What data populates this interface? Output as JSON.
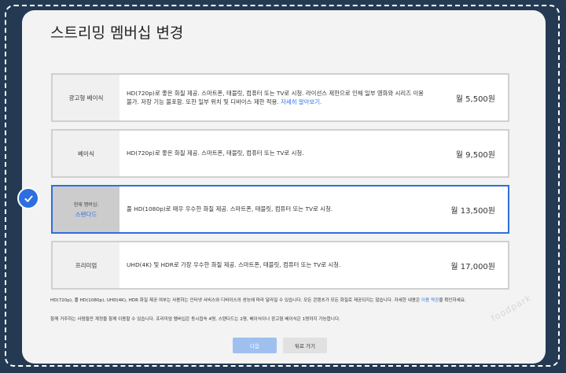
{
  "title": "스트리밍 멤버십 변경",
  "plans": [
    {
      "name": "광고형 베이식",
      "desc": "HD(720p)로 좋은 화질 제공. 스마트폰, 태블릿, 컴퓨터 또는 TV로 시청. 라이선스 제한으로 인해 일부 영화와 시리즈 이용 불가. 저장 기능 불포함. 또한 일부 위치 및 디바이스 제한 적용.",
      "more": "자세히 알아보기.",
      "price": "월 5,500원"
    },
    {
      "name": "베이식",
      "desc": "HD(720p)로 좋은 화질 제공. 스마트폰, 태블릿, 컴퓨터 또는 TV로 시청.",
      "price": "월 9,500원"
    },
    {
      "current_label": "현재 멤버십:",
      "name": "스탠다드",
      "desc": "풀 HD(1080p)로 매우 우수한 화질 제공. 스마트폰, 태블릿, 컴퓨터 또는 TV로 시청.",
      "price": "월 13,500원",
      "selected": true
    },
    {
      "name": "프리미엄",
      "desc": "UHD(4K) 및 HDR로 가장 우수한 화질 제공. 스마트폰, 태블릿, 컴퓨터 또는 TV로 시청.",
      "price": "월 17,000원"
    }
  ],
  "notes": {
    "line1": "HD(720p), 풀 HD(1080p), UHD(4K), HDR 화질 제공 여부는 사용하는 인터넷 서비스와 디바이스의 성능에 따라 달라질 수 있습니다. 모든 콘텐츠가 모든 화질로 제공되지는 않습니다. 자세한 내용은",
    "terms_link": "이용 약관",
    "line1_end": "을 확인하세요.",
    "line2": "함께 거주하는 사람들만 계정을 함께 이용할 수 있습니다. 프리미엄 멤버십은 동시접속 4명, 스탠다드는 2명, 베이식이나 광고형 베이식은 1명까지 가능합니다."
  },
  "buttons": {
    "next": "다음",
    "back": "뒤로 가기"
  },
  "watermark": "foodpark",
  "colors": {
    "accent": "#2d6fe0",
    "background": "#243a52"
  },
  "icons": {
    "selected": "check-circle-icon"
  }
}
